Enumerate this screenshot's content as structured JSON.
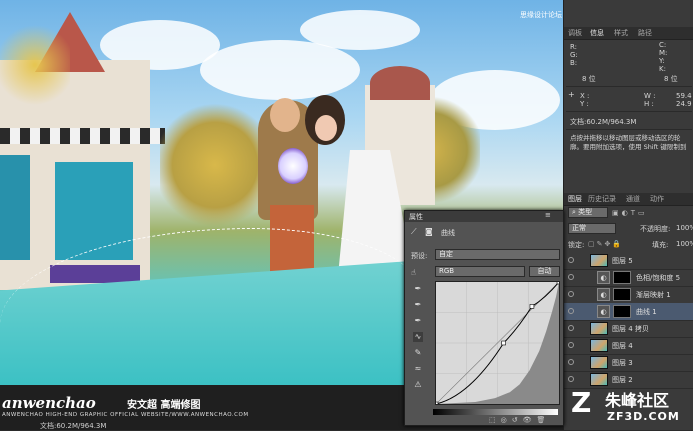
{
  "watermark_top": "思缘设计论坛 www.MISSYUAN.COM",
  "canvas": {
    "brand": "anwenchao",
    "brand_cn": "安文超 高端修图",
    "brand_sub": "ANWENCHAO HIGH-END GRAPHIC OFFICIAL WEBSITE/WWW.ANWENCHAO.COM",
    "status": "文档:60.2M/964.3M"
  },
  "info_panel": {
    "tabs": [
      "调板",
      "信息",
      "样式",
      "路径"
    ],
    "active_tab": 1,
    "left_labels": [
      "R:",
      "G:",
      "B:"
    ],
    "right_labels": [
      "C:",
      "M:",
      "Y:",
      "K:"
    ],
    "bit_left": "8 位",
    "bit_right": "8 位",
    "x_label": "X :",
    "y_label": "Y :",
    "w_label": "W :",
    "h_label": "H :",
    "w_value": "59.4",
    "h_value": "24.9",
    "doc": "文档:60.2M/964.3M",
    "hint": "点按并拖移以移动图层或移动选区的轮廓。要用附加选项，使用 Shift 键限制到 45 度增量方向"
  },
  "layers_panel": {
    "tabs": [
      "图层",
      "历史记录",
      "通道",
      "动作"
    ],
    "active_tab": 0,
    "filter_label": "类型",
    "blend_mode": "正常",
    "opacity_label": "不透明度:",
    "opacity_value": "100%",
    "lock_label": "锁定:",
    "fill_label": "填充:",
    "fill_value": "100%",
    "layers": [
      {
        "name": "图层 5",
        "selected": false,
        "kind": "pixel"
      },
      {
        "name": "色相/饱和度 5",
        "selected": false,
        "kind": "adjust"
      },
      {
        "name": "渐层映射 1",
        "selected": false,
        "kind": "adjust"
      },
      {
        "name": "曲线 1",
        "selected": true,
        "kind": "adjust"
      },
      {
        "name": "图层 4 拷贝",
        "selected": false,
        "kind": "pixel"
      },
      {
        "name": "图层 4",
        "selected": false,
        "kind": "pixel"
      },
      {
        "name": "图层 3",
        "selected": false,
        "kind": "pixel"
      },
      {
        "name": "图层 2",
        "selected": false,
        "kind": "pixel"
      }
    ]
  },
  "curves_dialog": {
    "title": "属性",
    "subtitle": "曲线",
    "preset_label": "预设:",
    "preset_value": "自定",
    "channel_value": "RGB",
    "auto_button": "自动"
  },
  "curve_points": [
    [
      0,
      0
    ],
    [
      0.55,
      0.5
    ],
    [
      0.78,
      0.8
    ],
    [
      1,
      1
    ]
  ],
  "logo": {
    "text": "朱峰社区",
    "url": "ZF3D.COM"
  },
  "colors": {
    "panel_bg": "#3a3a3a",
    "selected_layer": "#4b5a70",
    "accent": "#4fa3d9"
  }
}
